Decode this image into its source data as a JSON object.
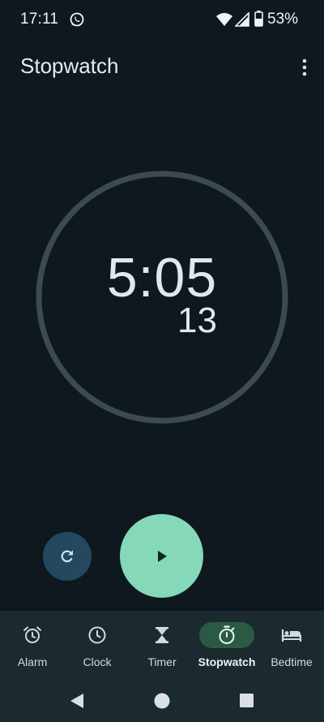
{
  "status_bar": {
    "time": "17:11",
    "battery_percent": "53%",
    "icons": [
      "whatsapp-icon",
      "wifi-icon",
      "signal-icon",
      "battery-icon"
    ]
  },
  "app_bar": {
    "title": "Stopwatch",
    "menu_icon": "more-vert-icon"
  },
  "stopwatch": {
    "time": "5:05",
    "hundredths": "13",
    "running": false
  },
  "controls": {
    "reset_icon": "reset-icon",
    "play_icon": "play-icon"
  },
  "bottom_nav": {
    "items": [
      {
        "label": "Alarm",
        "icon": "alarm-icon",
        "active": false
      },
      {
        "label": "Clock",
        "icon": "clock-icon",
        "active": false
      },
      {
        "label": "Timer",
        "icon": "hourglass-icon",
        "active": false
      },
      {
        "label": "Stopwatch",
        "icon": "stopwatch-icon",
        "active": true
      },
      {
        "label": "Bedtime",
        "icon": "bed-icon",
        "active": false
      }
    ]
  },
  "colors": {
    "background": "#0f181f",
    "dial_ring": "#3c4a52",
    "play_button": "#85d8b8",
    "reset_button": "#24495f",
    "nav_background": "#1a2a2f",
    "nav_active_pill": "#2a5a43"
  }
}
